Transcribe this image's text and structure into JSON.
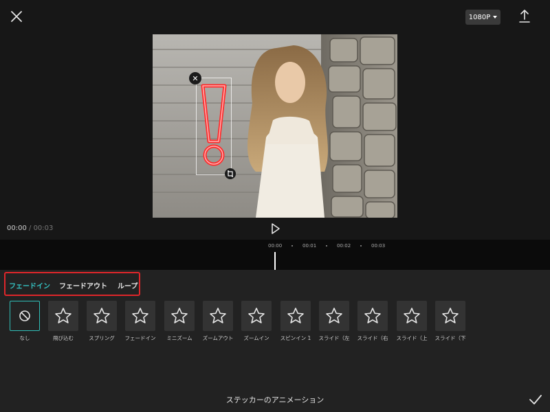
{
  "header": {
    "resolution_label": "1080P",
    "close_icon": "close-icon",
    "export_icon": "upload-icon"
  },
  "playback": {
    "current_time": "00:00",
    "separator": " / ",
    "total_time": "00:03"
  },
  "timeline": {
    "ticks": [
      "00:00",
      "00:01",
      "00:02",
      "00:03"
    ]
  },
  "tabs": {
    "fade_in": "フェードイン",
    "fade_out": "フェードアウト",
    "loop": "ループ",
    "active": "fade_in"
  },
  "animations": [
    {
      "label": "なし",
      "icon": "none-icon",
      "selected": true
    },
    {
      "label": "飛び込む",
      "icon": "star-icon"
    },
    {
      "label": "スプリング",
      "icon": "star-icon"
    },
    {
      "label": "フェードイン",
      "icon": "star-icon"
    },
    {
      "label": "ミニズーム",
      "icon": "star-icon"
    },
    {
      "label": "ズームアウト",
      "icon": "star-icon"
    },
    {
      "label": "ズームイン",
      "icon": "star-icon"
    },
    {
      "label": "スピンイン 1",
      "icon": "star-icon"
    },
    {
      "label": "スライド（左",
      "icon": "star-icon"
    },
    {
      "label": "スライド（右",
      "icon": "star-icon"
    },
    {
      "label": "スライド（上",
      "icon": "star-icon"
    },
    {
      "label": "スライド（下",
      "icon": "star-icon"
    }
  ],
  "footer": {
    "title": "ステッカーのアニメーション"
  },
  "colors": {
    "accent": "#35c3c3",
    "highlight_box": "#e0262a",
    "sticker_red": "#ff2b2b"
  }
}
